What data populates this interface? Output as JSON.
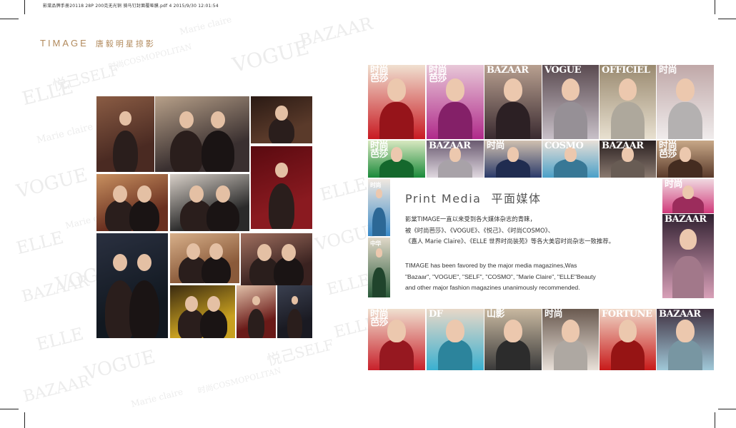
{
  "header": {
    "file_line": "影棠品牌手册20118 28P 200克无光铜 骑马钉封面覆哑膜.pdf   4   2015/9/30   12:01:54"
  },
  "brand": {
    "en": "TIMAGE",
    "cn": "唐毅明星掠影"
  },
  "print_media": {
    "title_en": "Print Media",
    "title_cn": "平面媒体",
    "cn_lines": [
      "影棠TIMAGE一直以来受到各大媒体杂志的青睐，",
      "被《时尚芭莎》、《VOGUE》、《悦己》、《时尚COSMO》、",
      "《嘉人 Marie Claire》、《ELLE 世界时尚装苑》等各大美容时尚杂志一致推荐。"
    ],
    "en_lines": [
      "TIMAGE has been favored by the major media magazines,Was",
      "\"Bazaar\", \"VOGUE\", \"SELF\", \"COSMO\", \"Marie Claire\",  \"ELLE\"Beauty",
      "and other major fashion magazines unanimously recommended."
    ]
  },
  "watermarks": [
    "ELLE",
    "VOGUE",
    "BAZAAR",
    "悦己SELF",
    "Marie claire",
    "时尚COSMOPOLITAN"
  ],
  "photos": [
    {
      "name": "photo-01",
      "colors": [
        "#4a2a22",
        "#8a5c44"
      ]
    },
    {
      "name": "photo-02",
      "colors": [
        "#3a3030",
        "#b7a089"
      ]
    },
    {
      "name": "photo-03",
      "colors": [
        "#5a3a2a",
        "#2a1a14"
      ]
    },
    {
      "name": "photo-04",
      "colors": [
        "#8a1a20",
        "#5a0a10"
      ]
    },
    {
      "name": "photo-05",
      "colors": [
        "#6a3020",
        "#c89060"
      ]
    },
    {
      "name": "photo-06",
      "colors": [
        "#2a2a2a",
        "#d8d0c8"
      ]
    },
    {
      "name": "photo-07",
      "colors": [
        "#111820",
        "#2a3040"
      ]
    },
    {
      "name": "photo-08",
      "colors": [
        "#8a5a3a",
        "#d8b08a"
      ]
    },
    {
      "name": "photo-09",
      "colors": [
        "#3a2220",
        "#a07060"
      ]
    },
    {
      "name": "photo-10",
      "colors": [
        "#c8a020",
        "#3a2a10"
      ]
    },
    {
      "name": "photo-11",
      "colors": [
        "#6a1a18",
        "#e0c0a8"
      ]
    },
    {
      "name": "photo-12",
      "colors": [
        "#1a1a22",
        "#3a4050"
      ]
    }
  ],
  "covers": [
    {
      "name": "cover-bazaar-red",
      "mast": "时尚\n芭莎",
      "colors": [
        "#c81a22",
        "#f0e0d0"
      ]
    },
    {
      "name": "cover-bazaar-purple",
      "mast": "时尚\n芭莎",
      "colors": [
        "#b02a8a",
        "#e8c8d8"
      ]
    },
    {
      "name": "cover-bazaar-dark",
      "mast": "BAZAAR",
      "colors": [
        "#3a2a30",
        "#b8a090"
      ]
    },
    {
      "name": "cover-vogue",
      "mast": "VOGUE",
      "colors": [
        "#c8c0c8",
        "#5a4a50"
      ]
    },
    {
      "name": "cover-officiel",
      "mast": "OFFICIEL",
      "colors": [
        "#e8e0d0",
        "#9a8a70"
      ]
    },
    {
      "name": "cover-cosmo-white",
      "mast": "时尚",
      "colors": [
        "#f0ecec",
        "#c0a8a8"
      ]
    },
    {
      "name": "cover-bazaar-green",
      "mast": "时尚\n芭莎",
      "colors": [
        "#1a8a3a",
        "#d8e8c0"
      ]
    },
    {
      "name": "cover-bazaar-30",
      "mast": "BAZAAR",
      "colors": [
        "#e0d8e0",
        "#6a5a70"
      ]
    },
    {
      "name": "cover-shang",
      "mast": "时尚",
      "colors": [
        "#2a3a6a",
        "#d0c0b0"
      ]
    },
    {
      "name": "cover-cosmo-blue",
      "mast": "COSMO",
      "colors": [
        "#4aa0c8",
        "#e8e0d8"
      ]
    },
    {
      "name": "cover-bazaar-grey",
      "mast": "BAZAAR",
      "colors": [
        "#8a7a70",
        "#2a2020"
      ]
    },
    {
      "name": "cover-bazaar-brown",
      "mast": "时尚\n芭莎",
      "colors": [
        "#5a3a2a",
        "#c8a888"
      ]
    },
    {
      "name": "cover-shishang-small",
      "mast": "时尚",
      "colors": [
        "#3a8ac8",
        "#f0e8e0"
      ]
    },
    {
      "name": "cover-china",
      "mast": "中华",
      "colors": [
        "#2a5a3a",
        "#e0d8c8"
      ]
    },
    {
      "name": "cover-shi-pink",
      "mast": "时尚",
      "colors": [
        "#d03a7a",
        "#f0d8e0"
      ]
    },
    {
      "name": "cover-bazaar-stripe",
      "mast": "BAZAAR",
      "colors": [
        "#d8a0b8",
        "#302030"
      ]
    },
    {
      "name": "cover-bottom-1",
      "mast": "时尚\n芭莎",
      "colors": [
        "#c8202a",
        "#f0e0d0"
      ]
    },
    {
      "name": "cover-bottom-2",
      "mast": "DF",
      "colors": [
        "#3ab0d0",
        "#e8d8c8"
      ]
    },
    {
      "name": "cover-bottom-3",
      "mast": "山影",
      "colors": [
        "#3a3a3a",
        "#c8b8a0"
      ]
    },
    {
      "name": "cover-bottom-4",
      "mast": "时尚",
      "colors": [
        "#e8e0d8",
        "#6a5a50"
      ]
    },
    {
      "name": "cover-bottom-5",
      "mast": "FORTUNE",
      "colors": [
        "#c81a1a",
        "#f0d8c8"
      ]
    },
    {
      "name": "cover-bottom-6",
      "mast": "BAZAAR",
      "colors": [
        "#a0c8d8",
        "#403040"
      ]
    }
  ]
}
